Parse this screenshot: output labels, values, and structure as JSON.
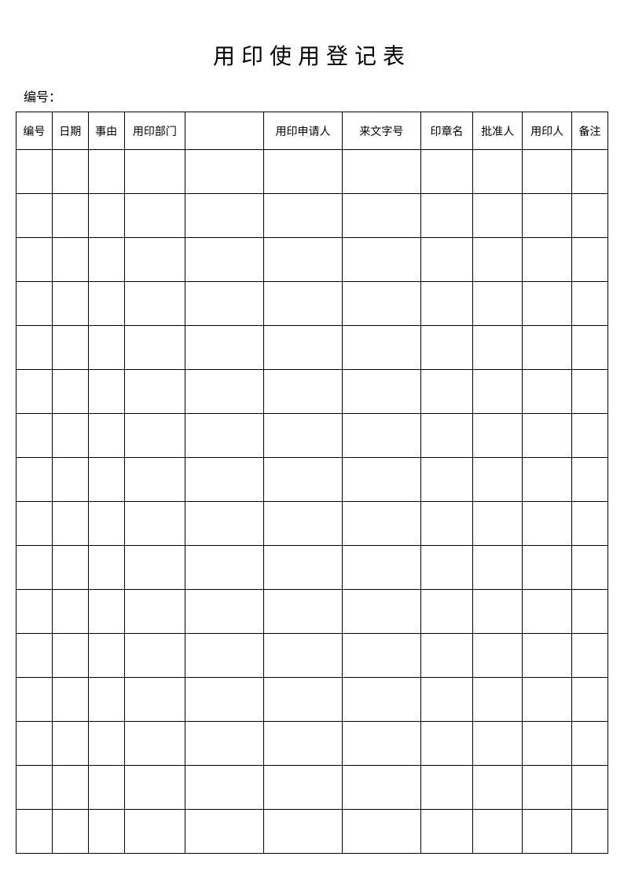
{
  "title": "用印使用登记表",
  "serial_label": "编号：",
  "headers": [
    "编号",
    "日期",
    "事由",
    "用印部门",
    "",
    "用印申请人",
    "来文字号",
    "印章名",
    "批准人",
    "用印人",
    "备注"
  ],
  "rows": 16
}
